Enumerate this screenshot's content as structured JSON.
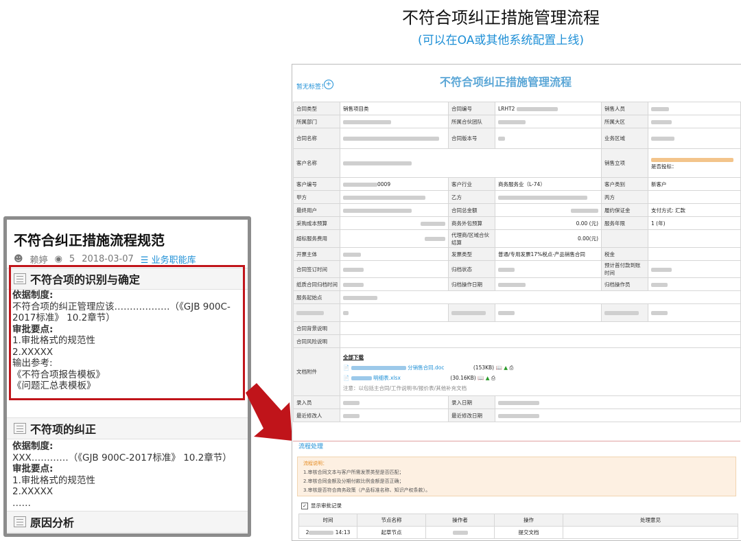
{
  "header": {
    "title": "不符合项纠正措施管理流程",
    "subtitle": "(可以在OA或其他系统配置上线)"
  },
  "left_panel": {
    "doc_title": "不符合纠正措施流程规范",
    "meta": {
      "author": "赖婷",
      "views": "5",
      "date": "2018-03-07",
      "library": "业务职能库"
    },
    "sections": [
      {
        "heading": "不符合项的识别与确定",
        "lines": [
          {
            "text": "依据制度:",
            "bold": true
          },
          {
            "text": "不符合项的纠正管理应该………………（《GJB 900C-2017标准》 10.2章节）",
            "bold": false
          },
          {
            "text": "审批要点:",
            "bold": true
          },
          {
            "text": "1.审批格式的规范性",
            "bold": false
          },
          {
            "text": "2.XXXXX",
            "bold": false
          },
          {
            "text": "输出参考:",
            "bold": false
          },
          {
            "text": "《不符合项报告模板》",
            "bold": false
          },
          {
            "text": "《问题汇总表模板》",
            "bold": false
          },
          {
            "text": "……",
            "bold": false
          }
        ]
      },
      {
        "heading": "不符项的纠正",
        "lines": [
          {
            "text": "依据制度:",
            "bold": true
          },
          {
            "text": "XXX…………（《GJB 900C-2017标准》 10.2章节）",
            "bold": false
          },
          {
            "text": "审批要点:",
            "bold": true
          },
          {
            "text": "1.审批格式的规范性",
            "bold": false
          },
          {
            "text": "2.XXXXX",
            "bold": false
          },
          {
            "text": "……",
            "bold": false
          }
        ]
      },
      {
        "heading": "原因分析",
        "lines": []
      }
    ]
  },
  "form": {
    "flag_label": "暂无标签！",
    "title": "不符合项纠正措施管理流程",
    "rows": [
      [
        "合同类型",
        "销售项目类",
        "合同编号",
        "LRHT2",
        "销售人员",
        ""
      ],
      [
        "所属部门",
        "",
        "所属合伙团队",
        "",
        "所属大区",
        ""
      ],
      [
        "合同名称",
        "",
        "合同版本号",
        "",
        "业务区域",
        ""
      ],
      [
        "客户名称",
        "",
        "",
        "",
        "销售立项",
        "是否投标："
      ],
      [
        "客户编号",
        "0009",
        "客户行业",
        "商务服务业（L-74）",
        "客户类别",
        "新客户"
      ],
      [
        "甲方",
        "",
        "乙方",
        "",
        "丙方",
        ""
      ],
      [
        "最终用户",
        "",
        "合同总金额",
        "",
        "履约保证金",
        "支付方式: 汇款"
      ],
      [
        "采购成本预算",
        "",
        "商务外包预算",
        "0.00 (元)",
        "服务年限",
        "1 (年)"
      ],
      [
        "超标服务费用",
        "",
        "代理商/区域合伙结算",
        "0.00(元)",
        "",
        ""
      ],
      [
        "开票主体",
        "",
        "发票类型",
        "普通/专用发票17%税点-产品销售合同",
        "税金",
        ""
      ],
      [
        "合同签订时间",
        "",
        "归档状态",
        "",
        "预计首付款到账时间",
        ""
      ],
      [
        "纸质合同归档时间",
        "",
        "归档操作日期",
        "",
        "归档操作员",
        ""
      ],
      [
        "服务起始点",
        "",
        "",
        "",
        "",
        ""
      ],
      [
        "",
        "",
        "",
        "",
        "",
        ""
      ],
      [
        "合同背景说明",
        "",
        "",
        "",
        "",
        ""
      ],
      [
        "合同风险说明",
        "",
        "",
        "",
        "",
        ""
      ]
    ],
    "attachments": {
      "label": "文档附件",
      "download_all": "全部下载",
      "files": [
        {
          "name": "分销售合同.doc",
          "size": "(153KB)"
        },
        {
          "name": "明细表.xlsx",
          "size": "(30.16KB)"
        }
      ],
      "note": "注意：以包括主合同/工作说明书/报价表/其他补充文档"
    },
    "footer_rows": [
      [
        "录入员",
        "",
        "录入日期",
        ""
      ],
      [
        "最近修改人",
        "",
        "最近修改日期",
        ""
      ]
    ],
    "process": {
      "heading": "流程处理",
      "note_title": "流程说明：",
      "notes": [
        "1.审核合同文本与客户所需发票类型是否匹配；",
        "2.审核合同金额及分期付款比例金额是否正确；",
        "3.审核是否符合商务政策（产品标准名称、知识产权条款）。"
      ],
      "show_record_label": "显示审批记录",
      "columns": [
        "时间",
        "节点名称",
        "操作者",
        "操作",
        "处理意见"
      ],
      "log_rows": [
        [
          "2",
          "14:13",
          "起草节点",
          "",
          "提交文档",
          ""
        ]
      ]
    }
  }
}
